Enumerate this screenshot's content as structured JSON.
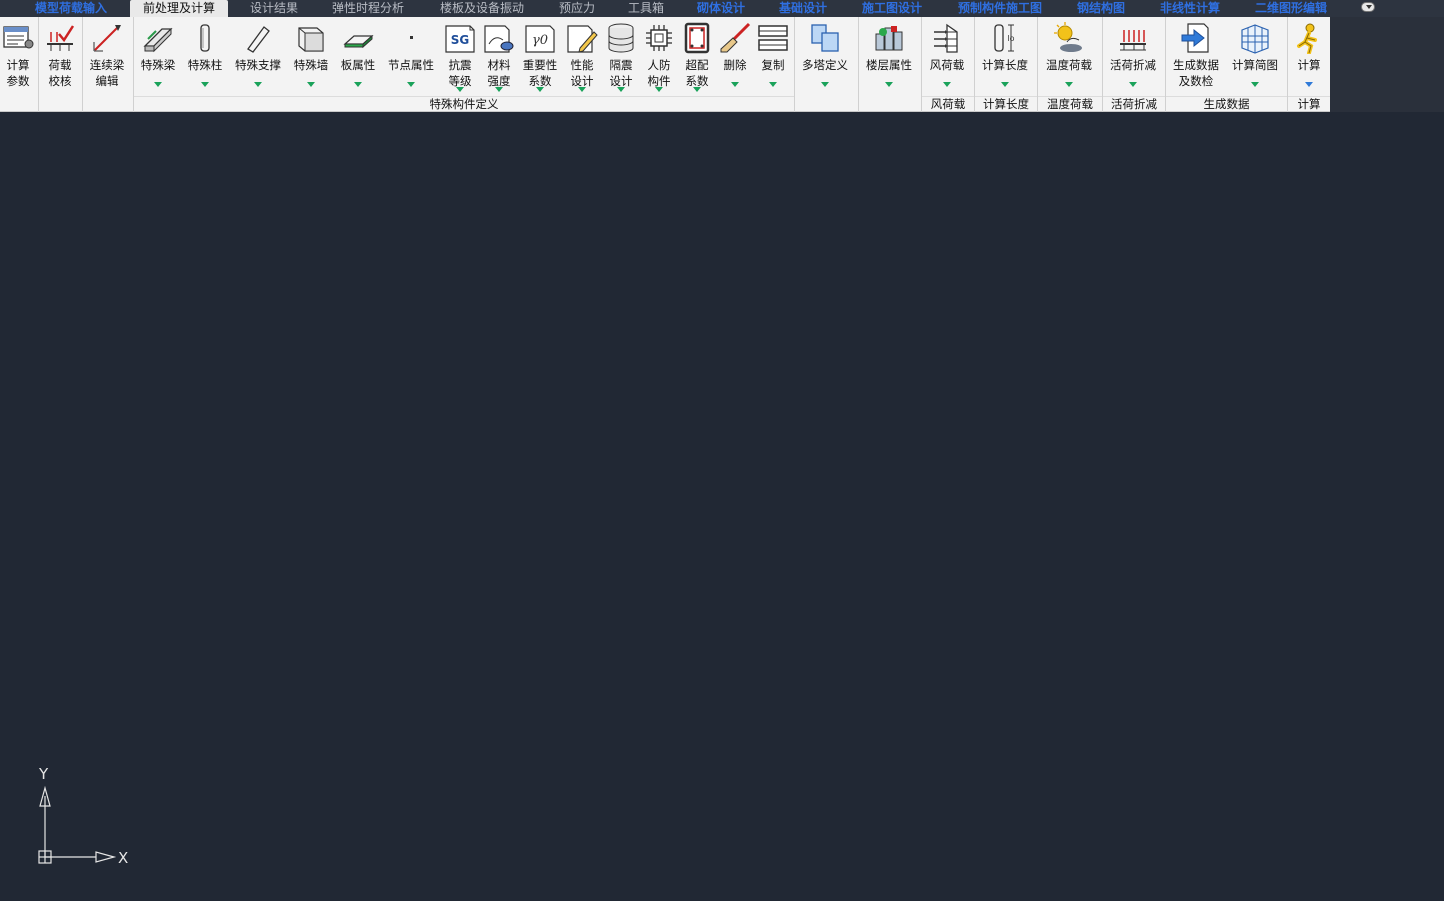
{
  "tabs": [
    {
      "label": "模型荷载输入",
      "style": "blue"
    },
    {
      "label": "前处理及计算",
      "style": "active"
    },
    {
      "label": "设计结果",
      "style": "normal"
    },
    {
      "label": "弹性时程分析",
      "style": "normal"
    },
    {
      "label": "楼板及设备振动",
      "style": "normal"
    },
    {
      "label": "预应力",
      "style": "normal"
    },
    {
      "label": "工具箱",
      "style": "normal"
    },
    {
      "label": "砌体设计",
      "style": "blue"
    },
    {
      "label": "基础设计",
      "style": "blue"
    },
    {
      "label": "施工图设计",
      "style": "blue"
    },
    {
      "label": "预制构件施工图",
      "style": "blue"
    },
    {
      "label": "钢结构图",
      "style": "blue"
    },
    {
      "label": "非线性计算",
      "style": "blue"
    },
    {
      "label": "二维图形编辑",
      "style": "blue"
    }
  ],
  "ribbon": {
    "buttons": {
      "calc_params": {
        "label": "计算\n参数",
        "icon": "calc-params-icon"
      },
      "load_check": {
        "label": "荷载\n校核",
        "icon": "load-check-icon"
      },
      "continuous_beam": {
        "label": "连续梁\n编辑",
        "icon": "continuous-beam-icon"
      },
      "special_beam": {
        "label": "特殊梁",
        "icon": "special-beam-icon"
      },
      "special_column": {
        "label": "特殊柱",
        "icon": "special-column-icon"
      },
      "special_brace": {
        "label": "特殊支撑",
        "icon": "special-brace-icon"
      },
      "special_wall": {
        "label": "特殊墙",
        "icon": "special-wall-icon"
      },
      "slab_props": {
        "label": "板属性",
        "icon": "slab-icon"
      },
      "node_props": {
        "label": "节点属性",
        "icon": "node-icon"
      },
      "seismic_grade": {
        "label": "抗震\n等级",
        "icon": "sg-icon",
        "icon_text": "SG"
      },
      "material_strength": {
        "label": "材料\n强度",
        "icon": "material-icon"
      },
      "importance_factor": {
        "label": "重要性\n系数",
        "icon": "gamma-icon",
        "icon_text": "γ0"
      },
      "performance_design": {
        "label": "性能\n设计",
        "icon": "performance-icon"
      },
      "isolation_design": {
        "label": "隔震\n设计",
        "icon": "isolation-icon"
      },
      "civil_defense": {
        "label": "人防\n构件",
        "icon": "chip-icon"
      },
      "over_reinforce": {
        "label": "超配\n系数",
        "icon": "over-reinforce-icon"
      },
      "delete": {
        "label": "删除",
        "icon": "brush-delete-icon"
      },
      "copy": {
        "label": "复制",
        "icon": "copy-icon"
      },
      "multi_tower": {
        "label": "多塔定义",
        "icon": "multi-tower-icon"
      },
      "floor_props": {
        "label": "楼层属性",
        "icon": "floor-props-icon"
      },
      "wind_load": {
        "label": "风荷载",
        "icon": "wind-load-icon"
      },
      "calc_length": {
        "label": "计算长度",
        "icon": "calc-length-icon"
      },
      "temp_load": {
        "label": "温度荷载",
        "icon": "temperature-icon"
      },
      "live_reduce": {
        "label": "活荷折减",
        "icon": "live-load-icon"
      },
      "gen_data": {
        "label": "生成数据\n及数检",
        "icon": "generate-data-icon"
      },
      "calc_diagram": {
        "label": "计算简图",
        "icon": "grid-diagram-icon"
      },
      "calculate": {
        "label": "计算",
        "icon": "run-icon"
      }
    },
    "groups": {
      "special_def": "特殊构件定义",
      "wind": "风荷载",
      "length": "计算长度",
      "temp": "温度荷载",
      "live": "活荷折减",
      "gen": "生成数据",
      "calc": "计算"
    }
  },
  "axes": {
    "x": "X",
    "y": "Y"
  },
  "colors": {
    "canvas": "#212834",
    "ribbon": "#f3f3f3",
    "accent_blue": "#2f6fe0",
    "arrow_green": "#1aa25a"
  }
}
